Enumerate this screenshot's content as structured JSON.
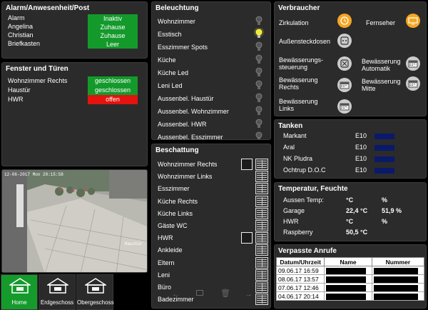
{
  "alarm": {
    "title": "Alarm/Anwesenheit/Post",
    "rows": [
      {
        "label": "Alarm",
        "value": "Inaktiv"
      },
      {
        "label": "Angelina",
        "value": "Zuhause"
      },
      {
        "label": "Christian",
        "value": "Zuhause"
      },
      {
        "label": "Briefkasten",
        "value": "Leer"
      }
    ]
  },
  "windows": {
    "title": "Fenster und Türen",
    "rows": [
      {
        "label": "Wohnzimmer Rechts",
        "value": "geschlossen",
        "status": "green"
      },
      {
        "label": "Haustür",
        "value": "geschlossen",
        "status": "green"
      },
      {
        "label": "HWR",
        "value": "offen",
        "status": "red"
      }
    ]
  },
  "camera": {
    "timestamp": "12-06-2017 Mon 20:15:58",
    "label": "Haustür"
  },
  "lighting": {
    "title": "Beleuchtung",
    "items": [
      {
        "label": "Wohnzimmer",
        "on": false
      },
      {
        "label": "Esstisch",
        "on": true
      },
      {
        "label": "Esszimmer Spots",
        "on": false
      },
      {
        "label": "Küche",
        "on": false
      },
      {
        "label": "Küche Led",
        "on": false
      },
      {
        "label": "Leni Led",
        "on": false
      },
      {
        "label": "Aussenbel. Haustür",
        "on": false
      },
      {
        "label": "Aussenbel. Wohnzimmer",
        "on": false
      },
      {
        "label": "Aussenbel. HWR",
        "on": false
      },
      {
        "label": "Aussenbel. Esszimmer",
        "on": false
      }
    ]
  },
  "shading": {
    "title": "Beschattung",
    "items": [
      {
        "label": "Wohnzimmer Rechts",
        "window": true
      },
      {
        "label": "Wohnzimmer Links",
        "window": false
      },
      {
        "label": "Esszimmer",
        "window": false
      },
      {
        "label": "Küche Rechts",
        "window": false
      },
      {
        "label": "Küche Links",
        "window": false
      },
      {
        "label": "Gäste WC",
        "window": false
      },
      {
        "label": "HWR",
        "window": true
      },
      {
        "label": "Ankleide",
        "window": false
      },
      {
        "label": "Eltern",
        "window": false
      },
      {
        "label": "Leni",
        "window": false
      },
      {
        "label": "Büro",
        "window": false
      },
      {
        "label": "Badezimmer",
        "window": false
      }
    ]
  },
  "consumers": {
    "title": "Verbraucher",
    "items": [
      {
        "label": "Zirkulation",
        "icon": "clock-icon",
        "color": "#f5a623"
      },
      {
        "label": "Fernseher",
        "icon": "tv-icon",
        "color": "#f5a623"
      },
      {
        "label": "Außensteckdosen",
        "icon": "socket-icon",
        "color": "#cccccc"
      },
      {
        "label": "Bewässerungs-\nsteuerung",
        "icon": "sprinkler-icon",
        "color": "#cccccc"
      },
      {
        "label": "Bewässerung\nAutomatik",
        "icon": "calendar-icon",
        "color": "#cccccc"
      },
      {
        "label": "Bewässerung\nRechts",
        "icon": "calendar-icon",
        "color": "#cccccc"
      },
      {
        "label": "Bewässerung\nMitte",
        "icon": "calendar-icon",
        "color": "#cccccc"
      },
      {
        "label": "Bewässerung\nLinks",
        "icon": "calendar-icon",
        "color": "#cccccc"
      }
    ]
  },
  "tanks": {
    "title": "Tanken",
    "rows": [
      {
        "station": "Markant",
        "fuel": "E10"
      },
      {
        "station": "Aral",
        "fuel": "E10"
      },
      {
        "station": "NK Pludra",
        "fuel": "E10"
      },
      {
        "station": "Ochtrup D.O.C",
        "fuel": "E10"
      }
    ]
  },
  "climate": {
    "title": "Temperatur, Feuchte",
    "rows": [
      {
        "label": "Aussen Temp:",
        "temp": "°C",
        "hum": "%"
      },
      {
        "label": "Garage",
        "temp": "22,4 °C",
        "hum": "51,9 %"
      },
      {
        "label": "HWR",
        "temp": "°C",
        "hum": "%"
      },
      {
        "label": "Raspberry",
        "temp": "50,5 °C",
        "hum": ""
      }
    ]
  },
  "calls": {
    "title": "Verpasste Anrufe",
    "headers": [
      "Datum/Uhrzeit",
      "Name",
      "Nummer"
    ],
    "rows": [
      {
        "date": "09.06.17 16:59"
      },
      {
        "date": "08.06.17 13:57"
      },
      {
        "date": "07.06.17 12:46"
      },
      {
        "date": "04.06.17 20:14"
      }
    ]
  },
  "nav": {
    "items": [
      {
        "label": "Home",
        "active": true
      },
      {
        "label": "Erdgeschoss",
        "active": false
      },
      {
        "label": "Obergeschoss",
        "active": false
      }
    ]
  }
}
